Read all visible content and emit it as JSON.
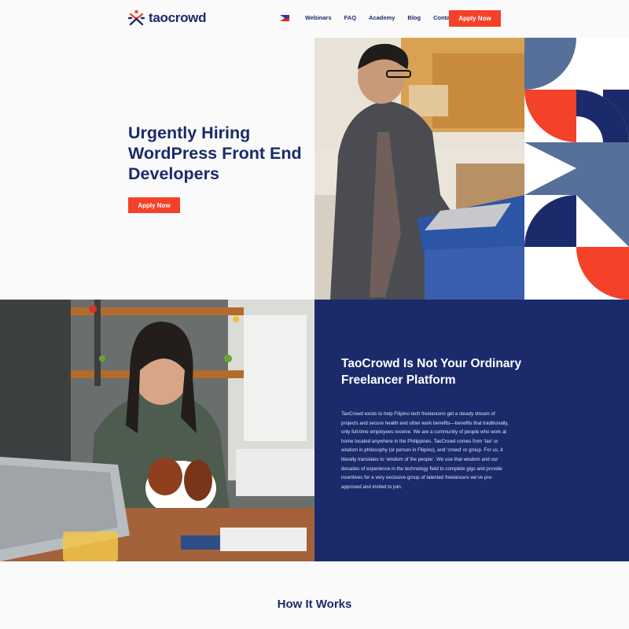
{
  "header": {
    "logo_text": "taocrowd",
    "flag_icon": "philippines-flag-icon",
    "nav": [
      "Webinars",
      "FAQ",
      "Academy",
      "Blog",
      "Contact"
    ],
    "cta_label": "Apply Now"
  },
  "hero": {
    "title": "Urgently Hiring WordPress Front End Developers",
    "cta_label": "Apply Now"
  },
  "about": {
    "title": "TaoCrowd Is Not Your Ordinary Freelancer Platform",
    "body": "TaoCrowd exists to help Filipino tech freelancers get a steady stream of projects and secure health and other work benefits—benefits that traditionally, only full-time employees receive. We are a community of people who work at home located anywhere in the Philippines. TaoCrowd comes from ‘tao’ or wisdom in philosophy (or person in Filipino), and ‘crowd’ or group. For us, it literally translates to ‘wisdom of the people’. We use that wisdom and our decades of experience in the technology field to complete gigs and provide incentives for a very exclusive group of talented freelancers we’ve pre-approved and invited to join."
  },
  "how_it_works": {
    "title": "How It Works"
  },
  "colors": {
    "navy": "#1b2a6b",
    "accent": "#f4412a",
    "slate": "#56709a",
    "background": "#fafafa"
  }
}
